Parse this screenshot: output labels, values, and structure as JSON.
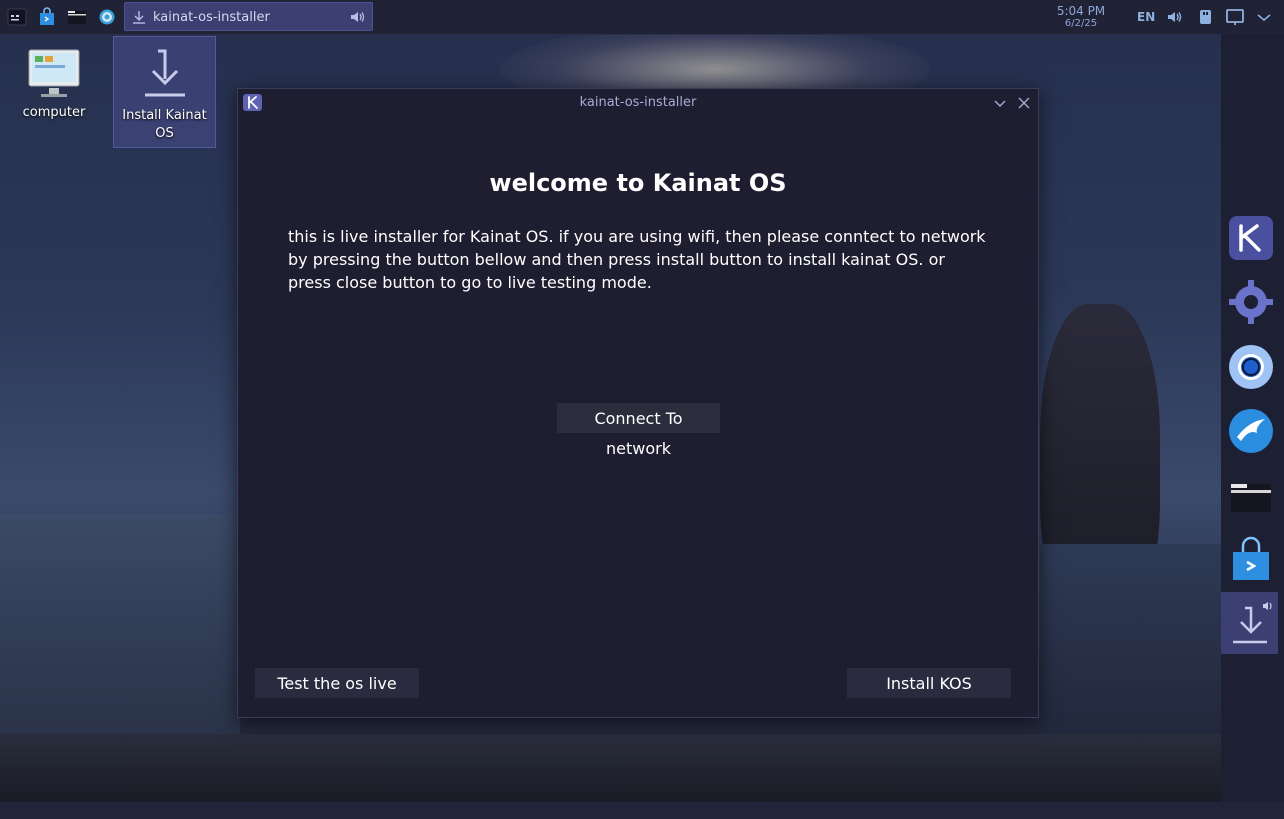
{
  "panel": {
    "icons": [
      "app-menu-icon",
      "store-icon",
      "files-icon",
      "settings-icon"
    ],
    "task": {
      "label": "kainat-os-installer",
      "icon": "download-icon",
      "audio_icon": "speaker-icon"
    },
    "clock": {
      "time": "5:04 PM",
      "date": "6/2/25"
    },
    "language": "EN",
    "tray_icons": [
      "volume-icon",
      "usb-icon",
      "display-icon",
      "chevron-down-icon"
    ]
  },
  "desktop": {
    "icons": [
      {
        "label": "computer",
        "icon": "computer-icon"
      },
      {
        "label": "Install Kainat OS",
        "icon": "download-icon"
      }
    ]
  },
  "dock": {
    "items": [
      "kainat-icon",
      "settings-gear-icon",
      "chromium-icon",
      "kainat-bird-icon",
      "folder-icon",
      "store-bag-icon",
      "installer-icon"
    ]
  },
  "window": {
    "title": "kainat-os-installer",
    "heading": "welcome to Kainat OS",
    "description": "this is live installer for Kainat OS. if you are using wifi, then please conntect to network by pressing the button bellow and then press install button to install kainat OS. or press close button to go to live testing mode.",
    "buttons": {
      "connect": "Connect To network",
      "test": "Test the os live",
      "install": "Install KOS"
    }
  },
  "colors": {
    "panel_bg": "#202236",
    "accent": "#3b3f72",
    "window_bg": "#1e1e30",
    "button_bg": "#2a2b3e"
  }
}
